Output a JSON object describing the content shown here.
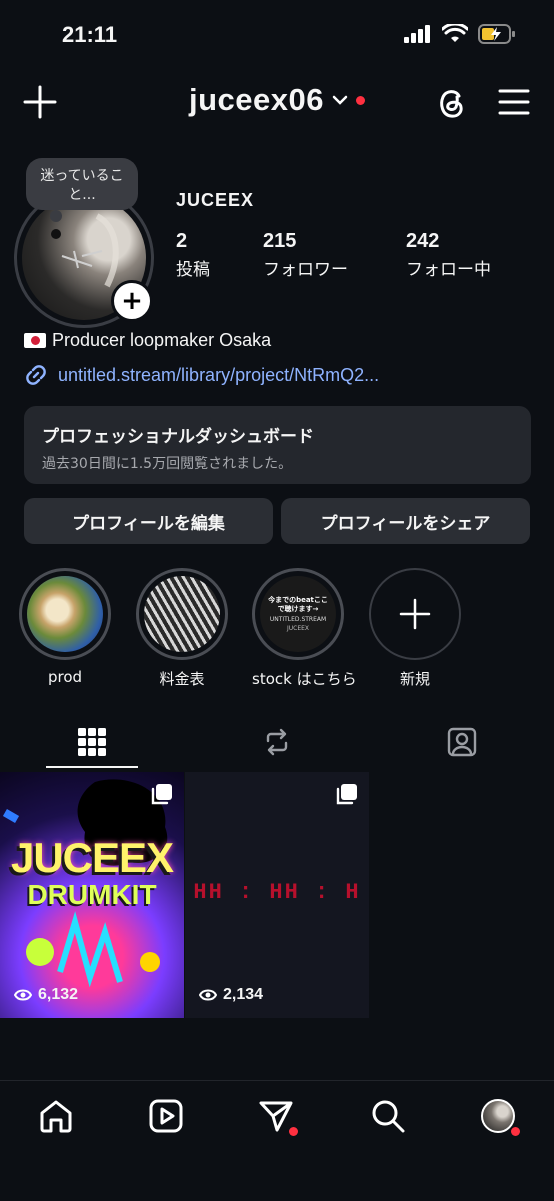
{
  "status": {
    "time": "21:11"
  },
  "header": {
    "username": "juceex06"
  },
  "profile": {
    "note": "迷っていること...",
    "display_name": "JUCEEX",
    "stats": [
      {
        "value": "2",
        "label": "投稿"
      },
      {
        "value": "215",
        "label": "フォロワー"
      },
      {
        "value": "242",
        "label": "フォロー中"
      }
    ],
    "bio": "Producer loopmaker Osaka",
    "link": "untitled.stream/library/project/NtRmQ2..."
  },
  "dashboard": {
    "title": "プロフェッショナルダッシュボード",
    "subtitle": "過去30日間に1.5万回閲覧されました。"
  },
  "buttons": {
    "edit": "プロフィールを編集",
    "share": "プロフィールをシェア"
  },
  "highlights": [
    {
      "label": "prod"
    },
    {
      "label": "料金表"
    },
    {
      "label": "stock はこちら",
      "cover_text": "今までのbeatここで聴けます→",
      "cover_sub": "UNTITLED.STREAM",
      "cover_name": "JUCEEX"
    },
    {
      "label": "新規"
    }
  ],
  "posts": [
    {
      "title_line1": "JUCEEX",
      "title_line2": "DRUMKIT",
      "views": "6,132"
    },
    {
      "overlay": "HH : HH : H",
      "views": "2,134"
    }
  ],
  "colors": {
    "background": "#0c0f14",
    "link": "#8fb3ff",
    "notification": "#ff3040"
  }
}
